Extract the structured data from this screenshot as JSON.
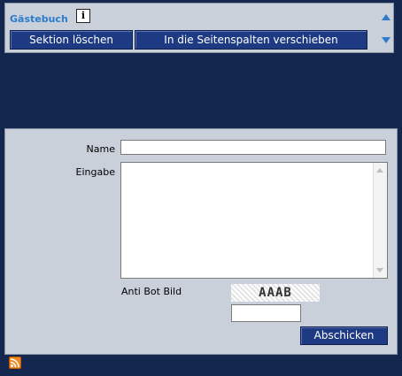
{
  "section": {
    "title": "Gästebuch",
    "info_glyph": "i",
    "delete_label": "Sektion löschen",
    "move_label": "In die Seitenspalten verschieben"
  },
  "form": {
    "name_label": "Name",
    "name_value": "",
    "entry_label": "Eingabe",
    "entry_value": "",
    "antibot_label": "Anti Bot Bild",
    "captcha_text": "AAAB",
    "captcha_value": "",
    "submit_label": "Abschicken"
  },
  "colors": {
    "page_background": "#14284f",
    "panel_background": "#c9d0da",
    "button_blue": "#1d3a82",
    "title_blue": "#2d7ccc",
    "rss_orange": "#f08a24"
  },
  "icons": [
    "info-icon",
    "move-up-icon",
    "move-down-icon",
    "rss-icon"
  ]
}
